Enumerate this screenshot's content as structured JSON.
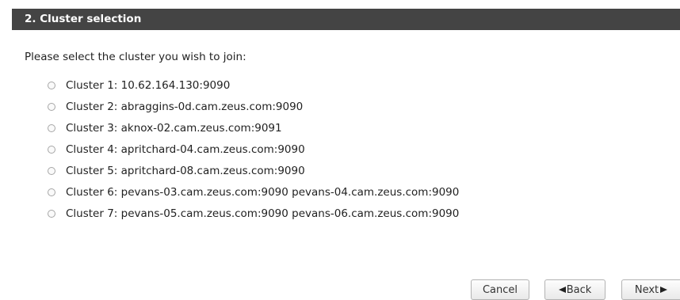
{
  "section": {
    "title": "2. Cluster selection"
  },
  "prompt": "Please select the cluster you wish to join:",
  "clusters": [
    {
      "label": "Cluster 1: 10.62.164.130:9090",
      "selected": false
    },
    {
      "label": "Cluster 2: abraggins-0d.cam.zeus.com:9090",
      "selected": false
    },
    {
      "label": "Cluster 3: aknox-02.cam.zeus.com:9091",
      "selected": false
    },
    {
      "label": "Cluster 4: apritchard-04.cam.zeus.com:9090",
      "selected": false
    },
    {
      "label": "Cluster 5: apritchard-08.cam.zeus.com:9090",
      "selected": false
    },
    {
      "label": "Cluster 6: pevans-03.cam.zeus.com:9090 pevans-04.cam.zeus.com:9090",
      "selected": false
    },
    {
      "label": "Cluster 7: pevans-05.cam.zeus.com:9090 pevans-06.cam.zeus.com:9090",
      "selected": false
    }
  ],
  "buttons": {
    "cancel": "Cancel",
    "back": "Back",
    "next": "Next",
    "back_icon": "triangle-left-icon",
    "next_icon": "triangle-right-icon"
  },
  "colors": {
    "header_background": "#444444",
    "header_text": "#ffffff",
    "body_text": "#222222"
  }
}
